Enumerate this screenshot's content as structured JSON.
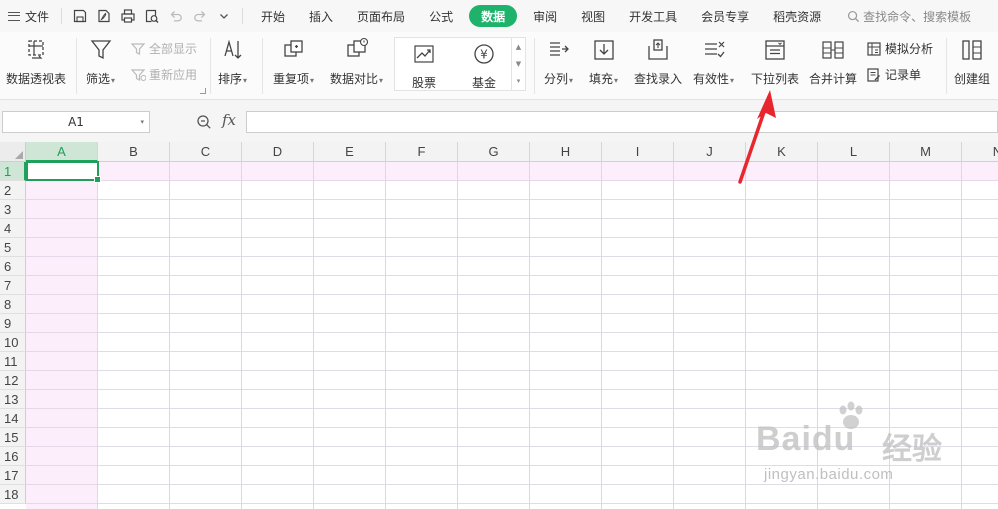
{
  "menubar": {
    "file_label": "文件",
    "tabs": [
      {
        "label": "开始"
      },
      {
        "label": "插入"
      },
      {
        "label": "页面布局"
      },
      {
        "label": "公式"
      },
      {
        "label": "数据"
      },
      {
        "label": "审阅"
      },
      {
        "label": "视图"
      },
      {
        "label": "开发工具"
      },
      {
        "label": "会员专享"
      },
      {
        "label": "稻壳资源"
      }
    ],
    "active_tab": "数据",
    "search_placeholder": "查找命令、搜索模板",
    "accent_color": "#1fb26b"
  },
  "ribbon": {
    "pivot_table": "数据透视表",
    "filter": "筛选",
    "show_all": "全部显示",
    "reapply": "重新应用",
    "sort": "排序",
    "duplicates": "重复项",
    "compare": "数据对比",
    "stock": "股票",
    "fund": "基金",
    "split_column": "分列",
    "fill": "填充",
    "lookup_entry": "查找录入",
    "validity": "有效性",
    "dropdown_list": "下拉列表",
    "consolidate": "合并计算",
    "what_if": "模拟分析",
    "record_form": "记录单",
    "create_group": "创建组"
  },
  "formula_bar": {
    "name_box": "A1",
    "fx_label": "fx",
    "formula": ""
  },
  "grid": {
    "columns": [
      "A",
      "B",
      "C",
      "D",
      "E",
      "F",
      "G",
      "H",
      "I",
      "J",
      "K",
      "L",
      "M",
      "N"
    ],
    "rows": [
      "1",
      "2",
      "3",
      "4",
      "5",
      "6",
      "7",
      "8",
      "9",
      "10",
      "11",
      "12",
      "13",
      "14",
      "15",
      "16",
      "17",
      "18"
    ],
    "selected_cell": "A1",
    "selection_color": "#1f9f5a"
  },
  "annotation": {
    "arrow_color": "#e8262d",
    "points_to": "下拉列表"
  },
  "watermark": {
    "brand": "Baidu",
    "brand_cn": "经验",
    "url": "jingyan.baidu.com"
  }
}
